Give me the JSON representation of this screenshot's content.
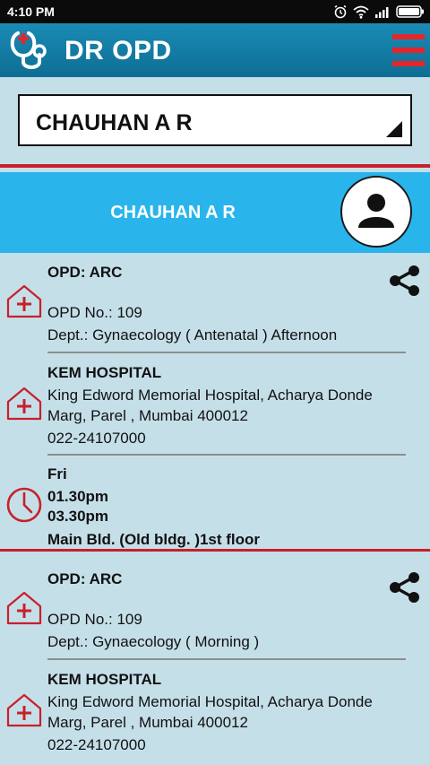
{
  "status_bar": {
    "time": "4:10 PM"
  },
  "app_bar": {
    "title": "DR OPD"
  },
  "doctor_select": {
    "value": "CHAUHAN A R"
  },
  "profile": {
    "name": "CHAUHAN A R"
  },
  "entries": [
    {
      "opd_title": "OPD: ARC",
      "opd_no": "OPD No.: 109",
      "dept": "Dept.: Gynaecology ( Antenatal ) Afternoon",
      "hospital_name": "KEM HOSPITAL",
      "address_line1": "King Edword Memorial Hospital, Acharya Donde",
      "address_line2": "Marg, Parel , Mumbai 400012",
      "phone": "022-24107000",
      "day": "Fri",
      "start_time": "01.30pm",
      "end_time": "03.30pm",
      "location": "Main Bld. (Old bldg. )1st floor"
    },
    {
      "opd_title": "OPD: ARC",
      "opd_no": "OPD No.: 109",
      "dept": "Dept.: Gynaecology ( Morning )",
      "hospital_name": "KEM HOSPITAL",
      "address_line1": "King Edword Memorial Hospital, Acharya Donde",
      "address_line2": "Marg, Parel , Mumbai 400012",
      "phone": "022-24107000"
    }
  ],
  "icons": {
    "logo": "stethoscope-icon",
    "menu": "hamburger-menu-icon",
    "avatar": "person-icon",
    "opd": "hospital-house-icon",
    "hospital": "hospital-house-icon",
    "time": "clock-icon",
    "share": "share-icon"
  },
  "colors": {
    "app_bar": "#1585ae",
    "banner": "#29b5ec",
    "background": "#c5dfe9",
    "accent_red": "#c8202a"
  }
}
